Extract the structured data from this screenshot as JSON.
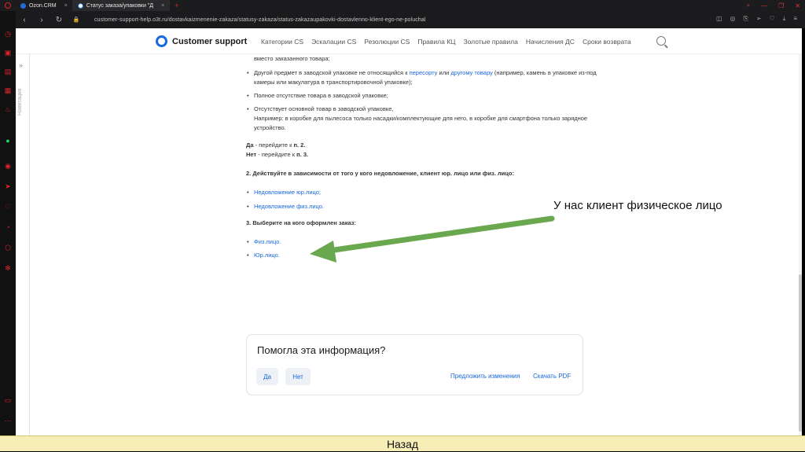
{
  "browser": {
    "tabs": [
      {
        "label": "Ozon.CRM"
      },
      {
        "label": "Статус заказа/упаковки \"Д"
      }
    ],
    "new_tab": "+",
    "url": "customer-support-help.o3t.ru/dostavkaizmenenie-zakaza/statusy-zakaza/status-zakazaupakovki-dostavlenno-klient-ego-ne-poluchal"
  },
  "site": {
    "logo_text": "Customer support",
    "nav": [
      "Категории CS",
      "Эскалации CS",
      "Резолюции CS",
      "Правила КЦ",
      "Золотые правила",
      "Начисления ДС",
      "Сроки возврата"
    ],
    "side_label": "Навигация"
  },
  "content": {
    "partial_line": "вместо заказанного товара;",
    "bullets": [
      {
        "pre": "Другой предмет в заводской упаковке не относящийся к ",
        "link1": "пересорту",
        "mid": " или ",
        "link2": "другому товару",
        "post": " (например, камень в упаковке из-под камеры или макулатура в транспортировочной упаковке);"
      },
      {
        "text": "Полное отсутствие товара в заводской упаковке;"
      },
      {
        "line1": "Отсутствует основной товар в заводской упаковке,",
        "line2": "Например: в коробке для пылесоса только насадки/комплектующие для него, в коробке для смартфона только зарядное устройство."
      }
    ],
    "yes_line": {
      "pre": "Да",
      "mid": " - перейдите к ",
      "step": "п. 2."
    },
    "no_line": {
      "pre": "Нет",
      "mid": " - перейдите к ",
      "step": "п. 3."
    },
    "step2_title": "2. Действуйте в зависимости от того у кого недовложение, клиент юр. лицо или физ. лицо:",
    "step2_links": [
      "Недовложение юр.лицо;",
      "Недовложение физ.лицо."
    ],
    "step3_title": "3. Выберите на кого оформлен заказ:",
    "step3_links": [
      "Физ.лицо.",
      "Юр.лицо."
    ]
  },
  "feedback": {
    "title": "Помогла эта информация?",
    "yes": "Да",
    "no": "Нет",
    "suggest": "Предложить изменения",
    "pdf": "Скачать PDF"
  },
  "annotation": {
    "text": "У нас клиент физическое лицо",
    "arrow_color": "#6aa84f"
  },
  "back_button": "Назад",
  "colors": {
    "link": "#1868e0",
    "opera_red": "#d9242c",
    "back_bar": "#f6edb7"
  }
}
